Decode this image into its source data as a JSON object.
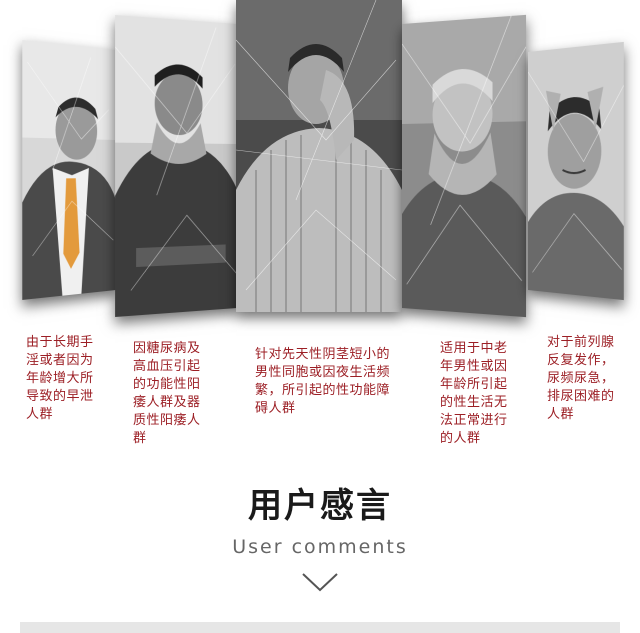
{
  "colors": {
    "caption": "#9c1f25",
    "heading": "#1a1a1a",
    "subheading": "#666666",
    "bar": "#e6e6e6"
  },
  "panels": [
    {
      "caption": "由于长期手淫或者因为年龄增大所导致的早泄人群"
    },
    {
      "caption": "因糖尿病及高血压引起的功能性阳痿人群及器质性阳痿人群"
    },
    {
      "caption": "针对先天性阴茎短小的男性同胞或因夜生活频繁，所引起的性功能障碍人群"
    },
    {
      "caption": "适用于中老年男性或因年龄所引起的性生活无法正常进行的人群"
    },
    {
      "caption": "对于前列腺反复发作，尿频尿急，排尿困难的人群"
    }
  ],
  "section": {
    "title": "用户感言",
    "subtitle": "User comments",
    "arrow_icon": "chevron-down-icon"
  }
}
